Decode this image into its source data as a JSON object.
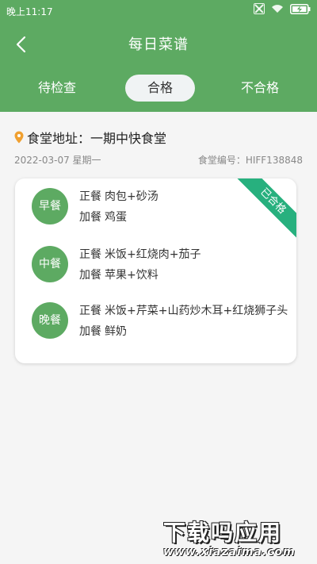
{
  "status_bar": {
    "time": "晚上11:17"
  },
  "nav": {
    "title": "每日菜谱",
    "back_icon": "chevron-left-icon"
  },
  "tabs": [
    {
      "label": "待检查",
      "active": false
    },
    {
      "label": "合格",
      "active": true
    },
    {
      "label": "不合格",
      "active": false
    }
  ],
  "canteen": {
    "address": "食堂地址：一期中快食堂",
    "date": "2022-03-07 星期一",
    "code": "食堂编号：HIFF138848"
  },
  "menu_card": {
    "status_ribbon": "已合格",
    "meals": [
      {
        "name": "早餐",
        "main_label": "正餐",
        "main": "肉包+砂汤",
        "extra_label": "加餐",
        "extra": "鸡蛋"
      },
      {
        "name": "中餐",
        "main_label": "正餐",
        "main": "米饭+红烧肉+茄子",
        "extra_label": "加餐",
        "extra": "苹果+饮料"
      },
      {
        "name": "晚餐",
        "main_label": "正餐",
        "main": "米饭+芹菜+山药炒木耳+红烧狮子头",
        "extra_label": "加餐",
        "extra": "鲜奶"
      }
    ]
  },
  "watermark": {
    "text": "下载吗应用",
    "url": "www.xiazaima.com"
  },
  "colors": {
    "header": "#5daa62",
    "ribbon": "#27b07e",
    "pin": "#f0a030"
  }
}
